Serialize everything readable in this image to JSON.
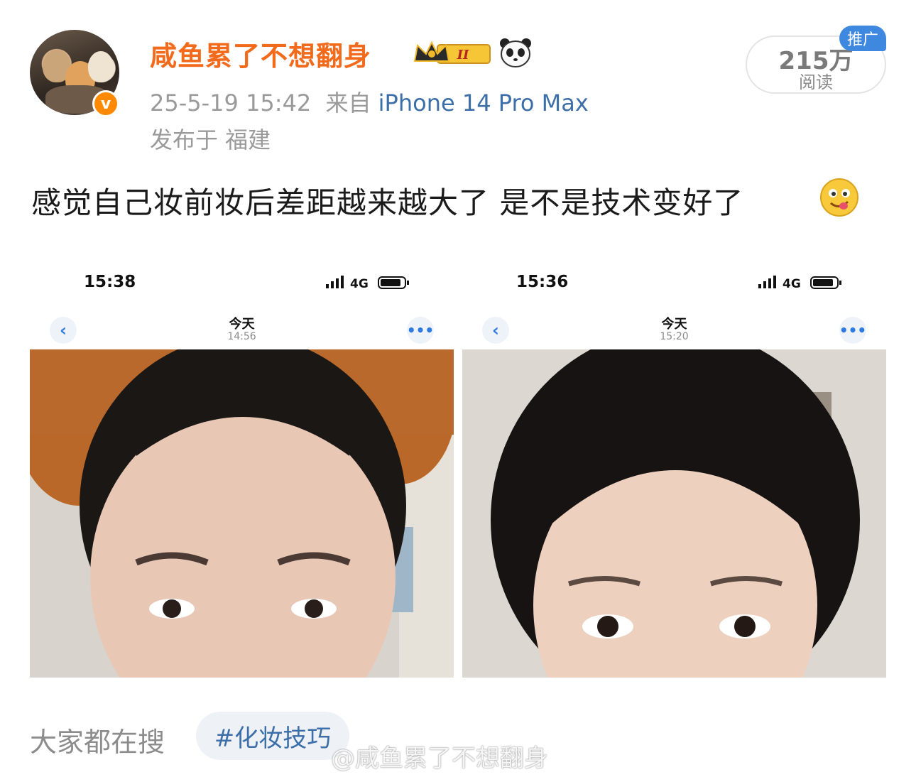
{
  "post": {
    "username": "咸鱼累了不想翻身",
    "timestamp": "25-5-19 15:42",
    "source_prefix": "来自",
    "device": "iPhone 14 Pro Max",
    "location": "发布于 福建",
    "verified_mark": "v",
    "level_badge": "II",
    "text": "感觉自己妆前妆后差距越来越大了 是不是技术变好了",
    "reads_count": "215万",
    "reads_label": "阅读",
    "promo_label": "推广"
  },
  "screenshots": [
    {
      "time": "15:38",
      "network": "4G",
      "nav_title": "今天",
      "nav_time": "14:56"
    },
    {
      "time": "15:36",
      "network": "4G",
      "nav_title": "今天",
      "nav_time": "15:20"
    }
  ],
  "footer": {
    "search_label": "大家都在搜",
    "tag": "#化妆技巧",
    "watermark": "@咸鱼累了不想翻身"
  },
  "colors": {
    "username": "#f26b1d",
    "link": "#3c6ea8",
    "meta": "#9a9a9a",
    "promo": "#3e88e0"
  },
  "icons": [
    "avatar",
    "verified-badge-icon",
    "crown-level-icon",
    "panda-icon",
    "drooling-emoji-icon",
    "back-chevron-icon",
    "more-dots-icon",
    "signal-icon",
    "battery-icon",
    "weibo-logo-icon"
  ]
}
